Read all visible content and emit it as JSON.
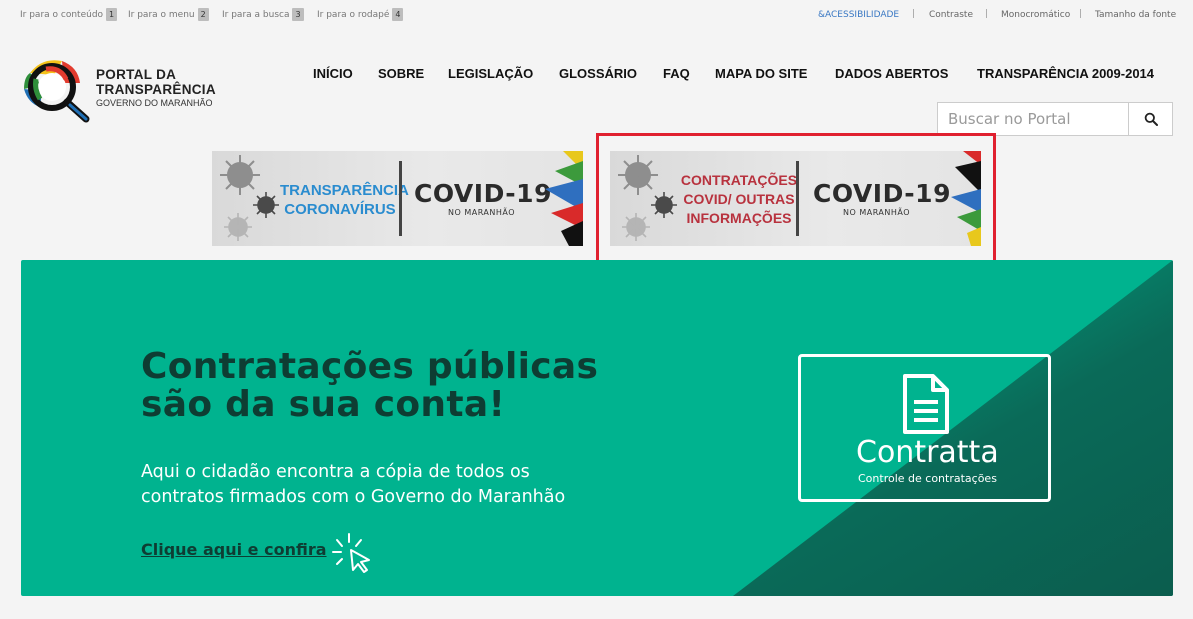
{
  "skip_links": [
    {
      "label": "Ir para o conteúdo",
      "key": "1"
    },
    {
      "label": "Ir para o menu",
      "key": "2"
    },
    {
      "label": "Ir para a busca",
      "key": "3"
    },
    {
      "label": "Ir para o rodapé",
      "key": "4"
    }
  ],
  "accessibility": {
    "acessibilidade": "&ACESSIBILIDADE",
    "contraste": "Contraste",
    "monocromatico": "Monocromático",
    "tamanho_fonte": "Tamanho da fonte",
    "separator": "|"
  },
  "logo": {
    "line1": "PORTAL DA",
    "line2": "TRANSPARÊNCIA",
    "line3": "GOVERNO DO MARANHÃO"
  },
  "nav": [
    "INÍCIO",
    "SOBRE",
    "LEGISLAÇÃO",
    "GLOSSÁRIO",
    "FAQ",
    "MAPA DO SITE",
    "DADOS ABERTOS",
    "TRANSPARÊNCIA 2009-2014"
  ],
  "search": {
    "placeholder": "Buscar no Portal"
  },
  "banners": [
    {
      "title_line1": "TRANSPARÊNCIA",
      "title_line2": "CORONAVÍRUS",
      "covid": "COVID-19",
      "sub": "NO MARANHÃO",
      "title_color": "#2a8ccf"
    },
    {
      "title_line1": "CONTRATAÇÕES",
      "title_line2": "COVID/ OUTRAS",
      "title_line3": "INFORMAÇÕES",
      "covid": "COVID-19",
      "sub": "NO MARANHÃO",
      "title_color": "#b8323e"
    }
  ],
  "hero": {
    "heading_line1": "Contratações públicas",
    "heading_line2": "são da sua conta!",
    "text_line1": "Aqui o cidadão encontra a cópia de todos os",
    "text_line2": "contratos firmados com o Governo do Maranhão",
    "cta": "Clique aqui e confira",
    "card_name": "Contratta",
    "card_sub": "Controle de contratações",
    "bg_color": "#00b38f"
  }
}
